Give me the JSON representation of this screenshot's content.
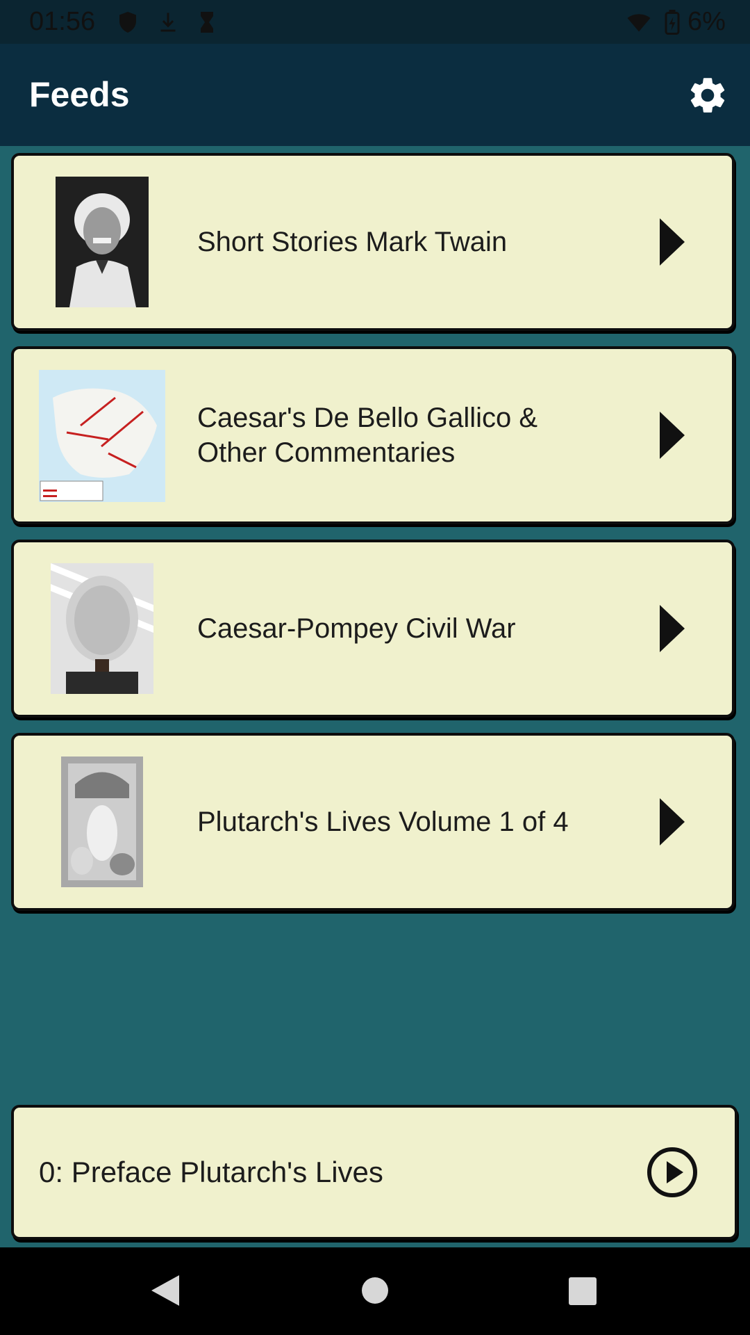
{
  "status_bar": {
    "time": "01:56",
    "icons": [
      "shield-icon",
      "download-icon",
      "hourglass-icon",
      "wifi-icon",
      "battery-icon"
    ],
    "battery": "6%"
  },
  "app_bar": {
    "title": "Feeds",
    "settings_icon": "gear-icon"
  },
  "feeds": [
    {
      "title": "Short Stories Mark Twain",
      "thumbnail": "portrait-photo"
    },
    {
      "title": "Caesar's De Bello Gallico & Other Commentaries",
      "thumbnail": "map-image"
    },
    {
      "title": "Caesar-Pompey Civil War",
      "thumbnail": "bust-photo"
    },
    {
      "title": "Plutarch's Lives Volume 1 of 4",
      "thumbnail": "engraving-image"
    }
  ],
  "player": {
    "now_playing": "0: Preface Plutarch's Lives",
    "play_icon": "play-circle-icon"
  },
  "nav_bar": {
    "buttons": [
      "back-icon",
      "home-icon",
      "recents-icon"
    ]
  },
  "colors": {
    "background": "#20646c",
    "app_bar": "#0b2d40",
    "card": "#f0f1cd"
  }
}
